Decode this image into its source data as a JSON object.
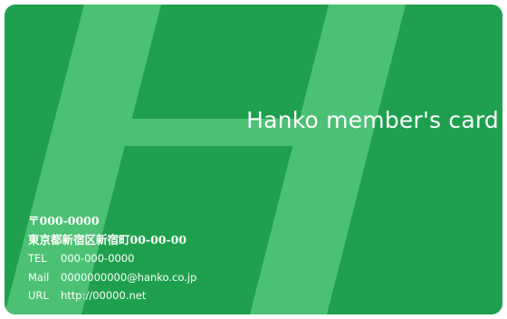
{
  "card": {
    "background_color": "#1fa04e",
    "watermark_color": "#4cc173",
    "title": "Hanko member's card",
    "postal": "〒000-0000",
    "address": "東京都新宿区新宿町00-00-00",
    "tel_label": "TEL",
    "tel_value": "000-000-0000",
    "mail_label": "Mail",
    "mail_value": "0000000000@hanko.co.jp",
    "url_label": "URL",
    "url_value": "http://00000.net"
  }
}
